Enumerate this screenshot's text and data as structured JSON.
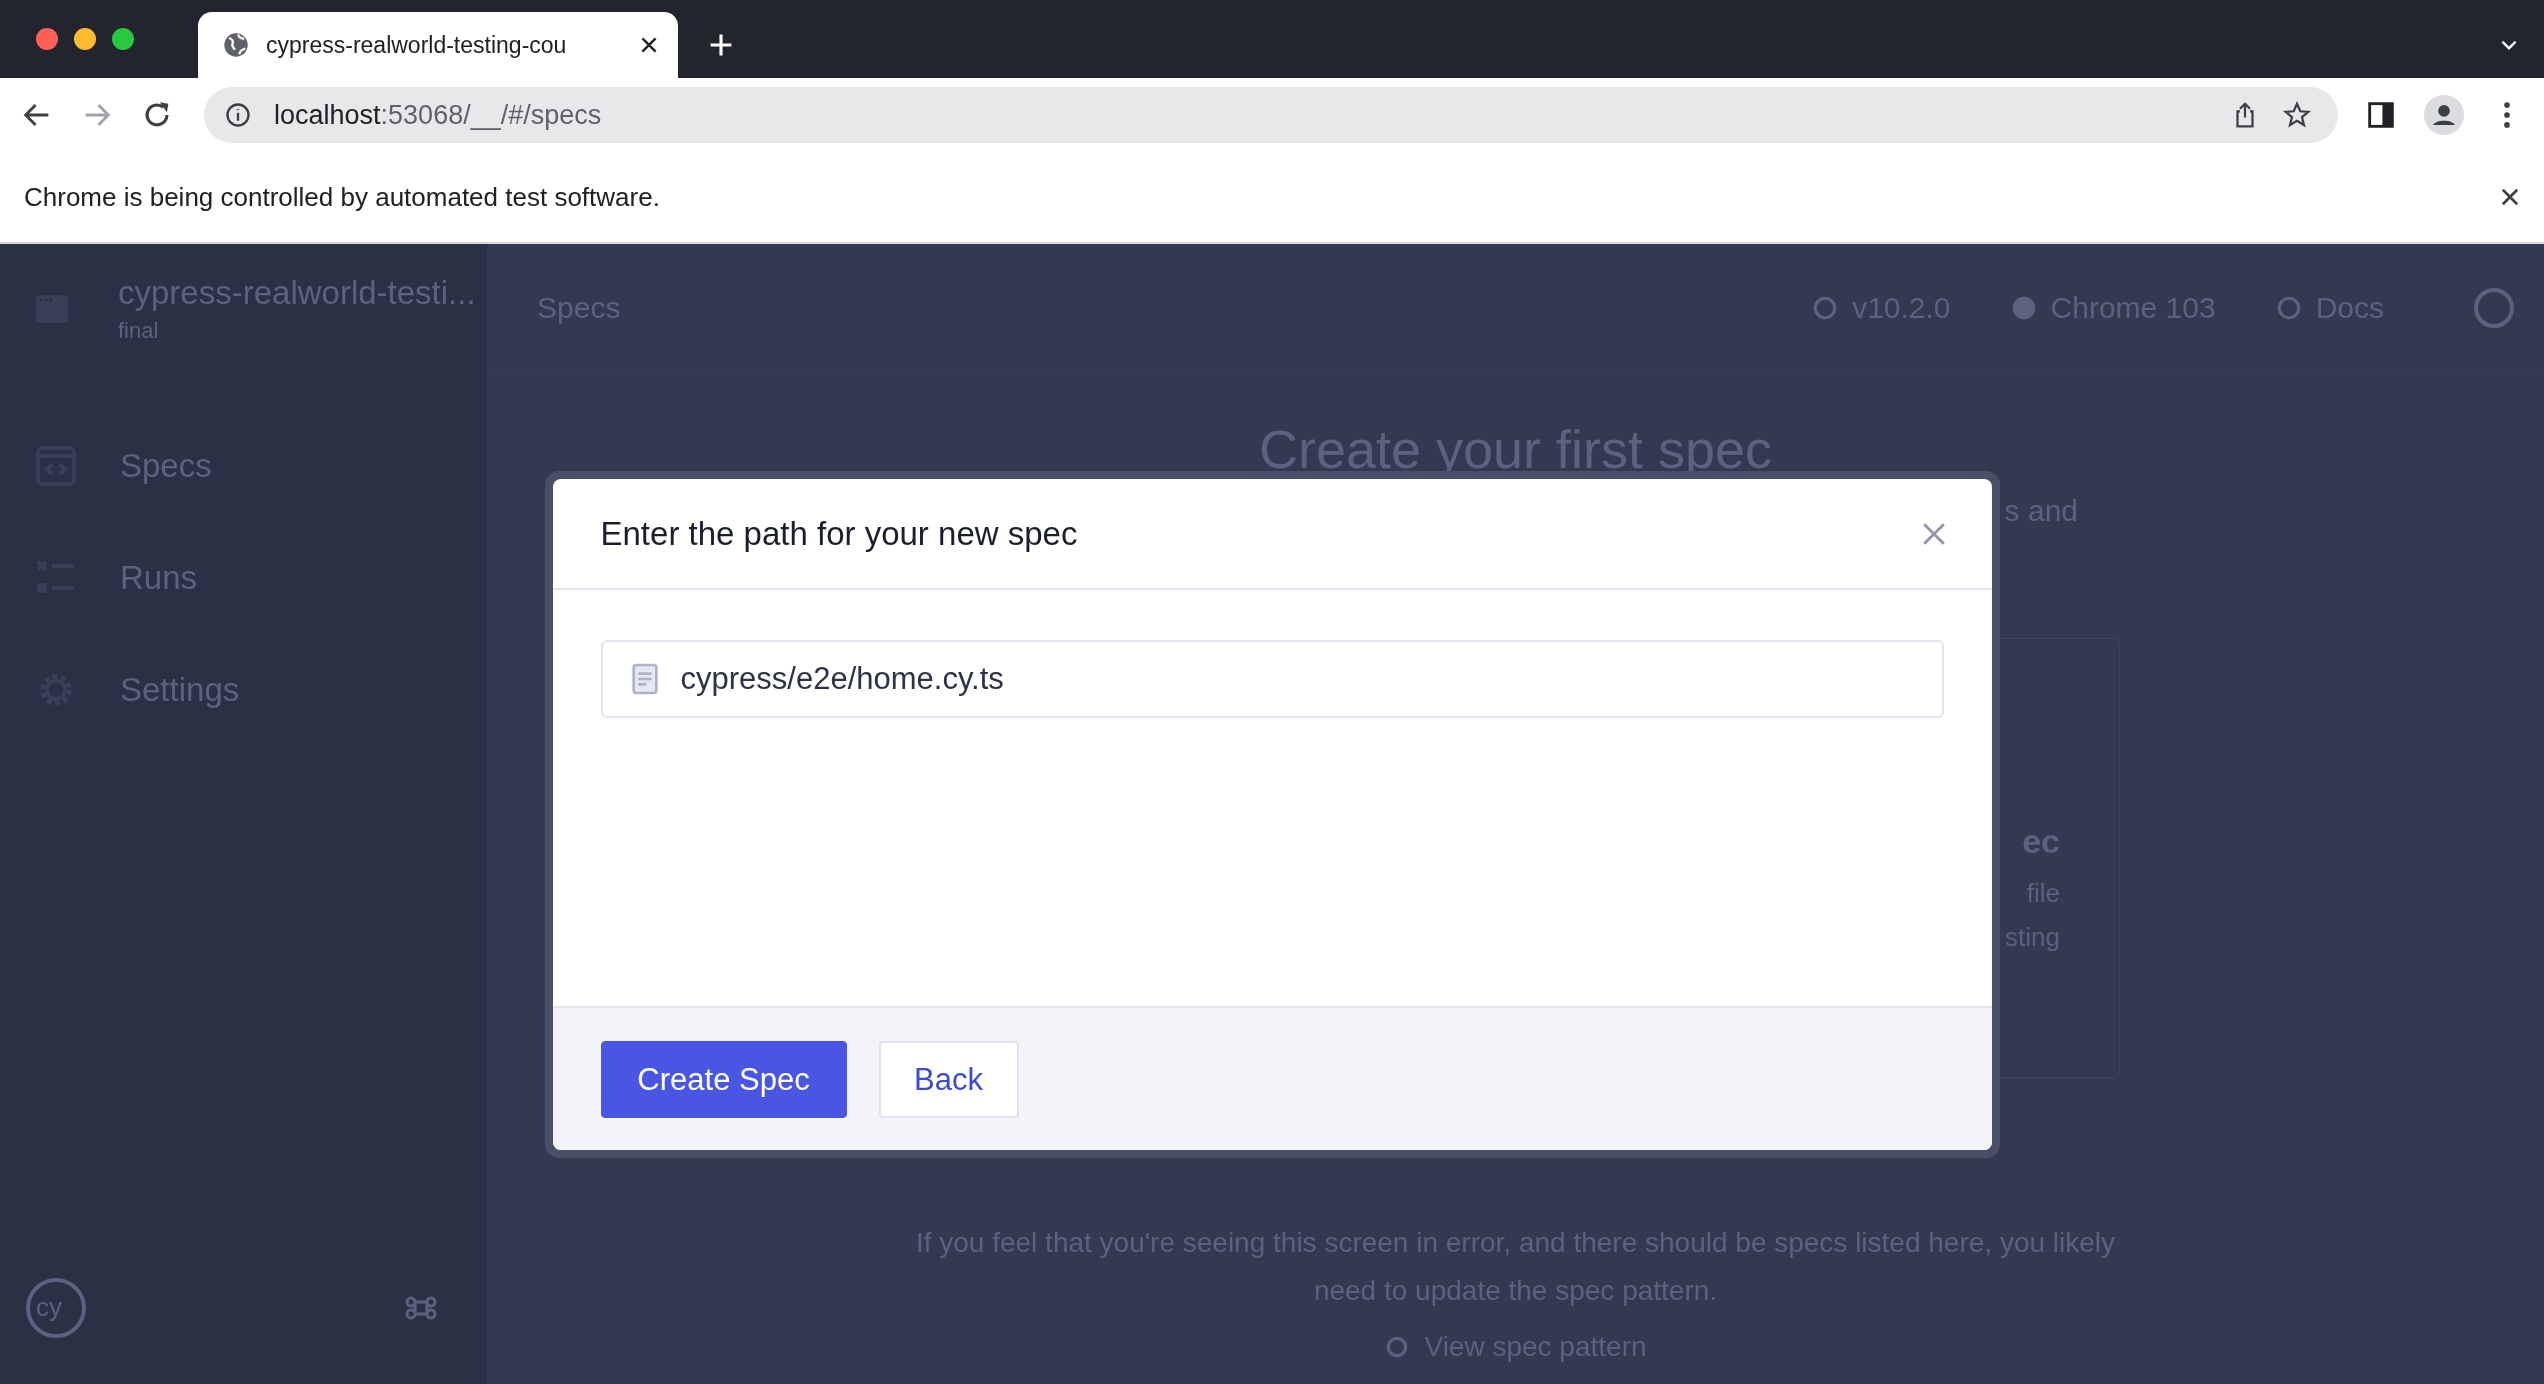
{
  "browser": {
    "tab": {
      "title": "cypress-realworld-testing-cou"
    },
    "address": {
      "host": "localhost",
      "path": ":53068/__/#/specs"
    },
    "banner": "Chrome is being controlled by automated test software."
  },
  "sidebar": {
    "logo": "cy",
    "project": "cypress-realworld-testi...",
    "branch": "final",
    "items": [
      {
        "label": "Specs",
        "kind": "specs"
      },
      {
        "label": "Runs",
        "kind": "runs"
      },
      {
        "label": "Settings",
        "kind": "settings"
      }
    ]
  },
  "header": {
    "title": "Specs",
    "version": "v10.2.0",
    "browser": "Chrome 103",
    "docs": "Docs"
  },
  "main": {
    "heading": "Create your first spec",
    "intro_fragment": "s and",
    "card_fragments": [
      {
        "text": "ec",
        "kind": "title"
      },
      {
        "text": "file",
        "kind": "body"
      },
      {
        "text": "sting",
        "kind": "body"
      }
    ],
    "notice": "If you feel that you're seeing this screen in error, and there should be specs listed here, you likely need to update the spec pattern.",
    "link": "View spec pattern"
  },
  "dialog": {
    "title": "Enter the path for your new spec",
    "path": "cypress/e2e/home.cy.ts",
    "buttons": [
      {
        "label": "Create Spec",
        "kind": "primary"
      },
      {
        "label": "Back",
        "kind": "secondary"
      }
    ]
  }
}
